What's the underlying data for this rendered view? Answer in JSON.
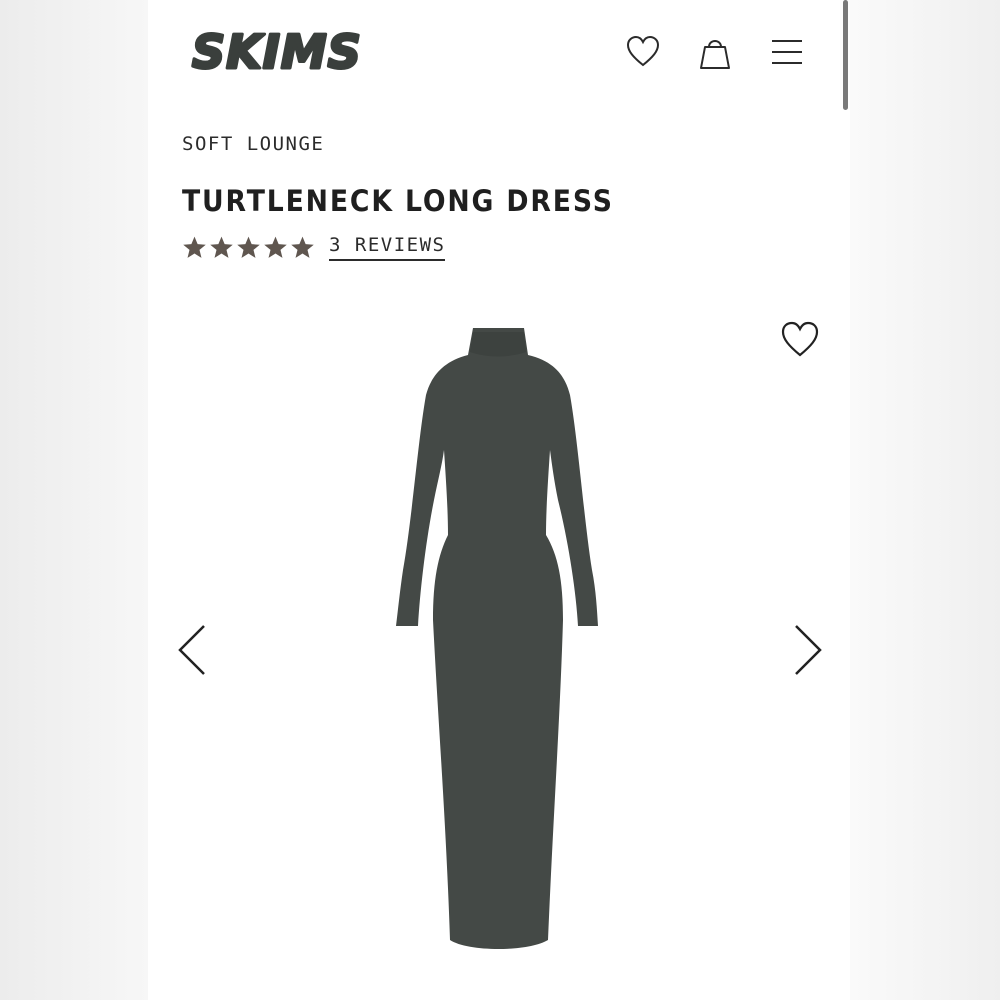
{
  "header": {
    "logo_text": "SKIMS",
    "icons": {
      "wishlist": "heart-icon",
      "bag": "shopping-bag-icon",
      "menu": "hamburger-menu-icon"
    }
  },
  "product": {
    "collection": "SOFT LOUNGE",
    "title": "TURTLENECK LONG DRESS",
    "rating": 5,
    "rating_max": 5,
    "reviews_label": "3 REVIEWS"
  },
  "gallery": {
    "image_subject": "long-sleeve turtleneck maxi dress",
    "icons": {
      "wishlist": "heart-icon",
      "prev": "chevron-left-icon",
      "next": "chevron-right-icon"
    }
  },
  "colors": {
    "dress": "#444946",
    "star": "#5f564f",
    "text": "#1f1f1f",
    "logo": "#3a3f3c"
  }
}
